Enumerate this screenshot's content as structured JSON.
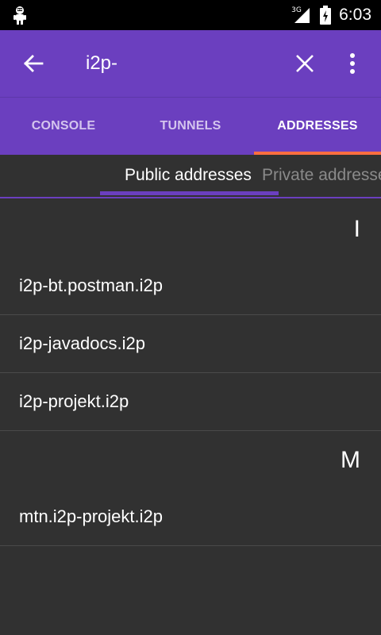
{
  "status_bar": {
    "network_type": "3G",
    "time": "6:03",
    "app_icon": "i2p-robot-icon"
  },
  "toolbar": {
    "search_value": "i2p-",
    "back_icon": "arrow-left-icon",
    "clear_icon": "close-icon",
    "overflow_icon": "more-vert-icon",
    "background_color": "#6b3fbf"
  },
  "tabs": [
    {
      "label": "CONSOLE",
      "active": false
    },
    {
      "label": "TUNNELS",
      "active": false
    },
    {
      "label": "ADDRESSES",
      "active": true
    }
  ],
  "tab_indicator_color": "#ff6e40",
  "subtabs": [
    {
      "label": "Public addresses",
      "active": true
    },
    {
      "label": "Private addresses",
      "active": false
    }
  ],
  "address_sections": [
    {
      "letter": "I",
      "items": [
        "i2p-bt.postman.i2p",
        "i2p-javadocs.i2p",
        "i2p-projekt.i2p"
      ]
    },
    {
      "letter": "M",
      "items": [
        "mtn.i2p-projekt.i2p"
      ]
    }
  ]
}
